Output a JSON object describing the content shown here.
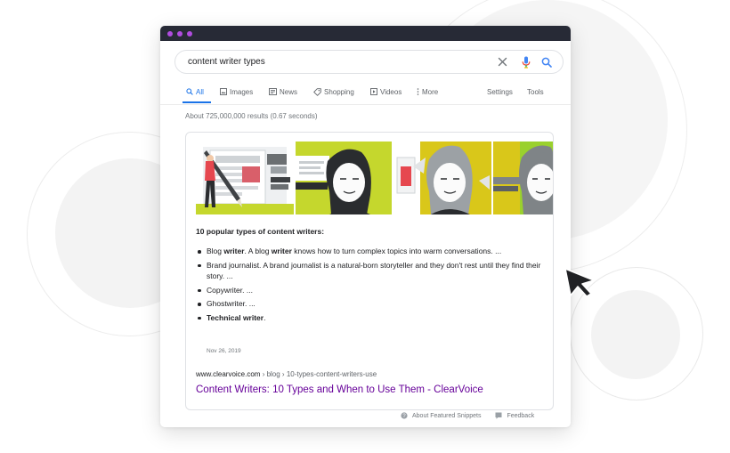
{
  "search": {
    "query": "content writer types"
  },
  "icons": {
    "clear": "close-icon",
    "voice": "microphone-icon",
    "search": "search-icon"
  },
  "tabs": [
    {
      "label": "All",
      "icon": "search-icon",
      "active": true
    },
    {
      "label": "Images",
      "icon": "image-icon",
      "active": false
    },
    {
      "label": "News",
      "icon": "news-icon",
      "active": false
    },
    {
      "label": "Shopping",
      "icon": "tag-icon",
      "active": false
    },
    {
      "label": "Videos",
      "icon": "play-icon",
      "active": false
    },
    {
      "label": "More",
      "icon": "more-vertical-icon",
      "active": false
    }
  ],
  "tools": {
    "settings_label": "Settings",
    "tools_label": "Tools"
  },
  "results_stats": "About 725,000,000 results (0.67 seconds)",
  "snippet": {
    "heading": "10 popular types of content writers:",
    "items": [
      {
        "pre": "Blog ",
        "b1": "writer",
        "mid": ". A blog ",
        "b2": "writer",
        "post": " knows how to turn complex topics into warm conversations. ..."
      },
      {
        "pre": "Brand journalist. A brand journalist is a natural-born storyteller and they don't rest until they find their story. ...",
        "b1": "",
        "mid": "",
        "b2": "",
        "post": ""
      },
      {
        "pre": "Copywriter. ...",
        "b1": "",
        "mid": "",
        "b2": "",
        "post": ""
      },
      {
        "pre": "Ghostwriter. ...",
        "b1": "",
        "mid": "",
        "b2": "",
        "post": ""
      },
      {
        "pre": "",
        "b1": "Technical writer",
        "mid": ".",
        "b2": "",
        "post": ""
      }
    ],
    "date": "Nov 26, 2019",
    "url_domain": "www.clearvoice.com",
    "url_path": " › blog › 10-types-content-writers-use",
    "link_title": "Content Writers: 10 Types and When to Use Them - ClearVoice"
  },
  "footer": {
    "about_label": "About Featured Snippets",
    "feedback_label": "Feedback"
  },
  "colors": {
    "accent_blue": "#1a73e8",
    "link_purple": "#660099",
    "titlebar": "#272a36",
    "window_dot": "#b04ce0",
    "banner_lime": "#c5d72d",
    "banner_yellow": "#d9c71a"
  }
}
